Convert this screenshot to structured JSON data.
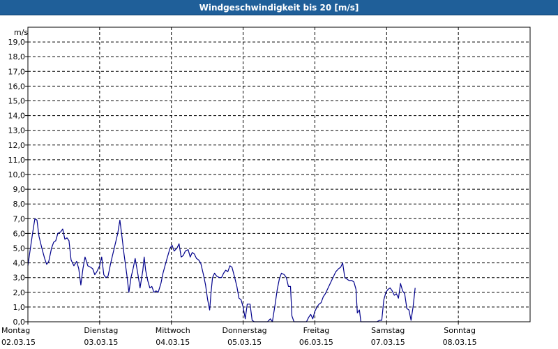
{
  "window": {
    "title": "Windgeschwindigkeit bis 20 [m/s]"
  },
  "chart_data": {
    "type": "line",
    "title": "Windgeschwindigkeit bis 20 [m/s]",
    "ylabel": "m/s",
    "xlabel": "",
    "ylim": [
      0,
      20
    ],
    "xlim": [
      0,
      7
    ],
    "grid": true,
    "line_color": "#00008b",
    "yticks": [
      "19,0",
      "18,0",
      "17,0",
      "16,0",
      "15,0",
      "14,0",
      "13,0",
      "12,0",
      "11,0",
      "10,0",
      "9,0",
      "8,0",
      "7,0",
      "6,0",
      "5,0",
      "4,0",
      "3,0",
      "2,0",
      "1,0",
      "0,0"
    ],
    "xticks": [
      {
        "day": "Montag",
        "date": "02.03.15"
      },
      {
        "day": "Dienstag",
        "date": "03.03.15"
      },
      {
        "day": "Mittwoch",
        "date": "04.03.15"
      },
      {
        "day": "Donnerstag",
        "date": "05.03.15"
      },
      {
        "day": "Freitag",
        "date": "06.03.15"
      },
      {
        "day": "Samstag",
        "date": "07.03.15"
      },
      {
        "day": "Sonntag",
        "date": "08.03.15"
      }
    ],
    "series": [
      {
        "points": [
          [
            0.0,
            3.8
          ],
          [
            0.029,
            4.8
          ],
          [
            0.068,
            6.1
          ],
          [
            0.097,
            7.0
          ],
          [
            0.126,
            6.9
          ],
          [
            0.155,
            5.8
          ],
          [
            0.194,
            5.0
          ],
          [
            0.233,
            4.3
          ],
          [
            0.262,
            3.9
          ],
          [
            0.291,
            4.1
          ],
          [
            0.33,
            5.0
          ],
          [
            0.359,
            5.4
          ],
          [
            0.388,
            5.5
          ],
          [
            0.417,
            6.0
          ],
          [
            0.456,
            6.1
          ],
          [
            0.485,
            6.3
          ],
          [
            0.515,
            5.6
          ],
          [
            0.544,
            5.7
          ],
          [
            0.573,
            5.5
          ],
          [
            0.602,
            4.2
          ],
          [
            0.641,
            3.8
          ],
          [
            0.68,
            4.1
          ],
          [
            0.709,
            3.6
          ],
          [
            0.738,
            2.5
          ],
          [
            0.767,
            3.6
          ],
          [
            0.796,
            4.4
          ],
          [
            0.835,
            3.8
          ],
          [
            0.874,
            3.7
          ],
          [
            0.903,
            3.6
          ],
          [
            0.932,
            3.2
          ],
          [
            0.961,
            3.4
          ],
          [
            1.0,
            3.8
          ],
          [
            1.029,
            4.4
          ],
          [
            1.058,
            3.2
          ],
          [
            1.087,
            3.0
          ],
          [
            1.117,
            3.1
          ],
          [
            1.155,
            4.0
          ],
          [
            1.184,
            4.6
          ],
          [
            1.223,
            5.4
          ],
          [
            1.252,
            6.0
          ],
          [
            1.282,
            6.9
          ],
          [
            1.311,
            5.8
          ],
          [
            1.34,
            4.6
          ],
          [
            1.379,
            3.2
          ],
          [
            1.408,
            2.0
          ],
          [
            1.437,
            3.0
          ],
          [
            1.466,
            3.6
          ],
          [
            1.495,
            4.3
          ],
          [
            1.534,
            3.2
          ],
          [
            1.563,
            2.3
          ],
          [
            1.602,
            3.5
          ],
          [
            1.621,
            4.4
          ],
          [
            1.641,
            3.5
          ],
          [
            1.67,
            2.8
          ],
          [
            1.699,
            2.3
          ],
          [
            1.728,
            2.4
          ],
          [
            1.757,
            2.0
          ],
          [
            1.786,
            2.1
          ],
          [
            1.816,
            2.0
          ],
          [
            1.854,
            2.6
          ],
          [
            1.883,
            3.3
          ],
          [
            1.922,
            4.0
          ],
          [
            1.951,
            4.5
          ],
          [
            1.981,
            5.0
          ],
          [
            2.01,
            5.2
          ],
          [
            2.039,
            4.8
          ],
          [
            2.078,
            5.0
          ],
          [
            2.107,
            5.3
          ],
          [
            2.136,
            4.4
          ],
          [
            2.165,
            4.5
          ],
          [
            2.194,
            4.8
          ],
          [
            2.233,
            4.9
          ],
          [
            2.262,
            4.4
          ],
          [
            2.291,
            4.7
          ],
          [
            2.32,
            4.6
          ],
          [
            2.35,
            4.3
          ],
          [
            2.379,
            4.2
          ],
          [
            2.408,
            4.0
          ],
          [
            2.447,
            3.2
          ],
          [
            2.476,
            2.5
          ],
          [
            2.505,
            1.5
          ],
          [
            2.534,
            0.8
          ],
          [
            2.553,
            2.0
          ],
          [
            2.573,
            3.0
          ],
          [
            2.602,
            3.3
          ],
          [
            2.631,
            3.1
          ],
          [
            2.67,
            3.0
          ],
          [
            2.699,
            3.0
          ],
          [
            2.728,
            3.3
          ],
          [
            2.757,
            3.5
          ],
          [
            2.786,
            3.4
          ],
          [
            2.816,
            3.8
          ],
          [
            2.845,
            3.7
          ],
          [
            2.883,
            3.0
          ],
          [
            2.913,
            2.4
          ],
          [
            2.942,
            1.6
          ],
          [
            2.971,
            1.5
          ],
          [
            3.0,
            1.0
          ],
          [
            3.029,
            0.2
          ],
          [
            3.058,
            1.2
          ],
          [
            3.097,
            1.2
          ],
          [
            3.126,
            0.1
          ],
          [
            3.155,
            0.0
          ],
          [
            3.34,
            0.0
          ],
          [
            3.379,
            0.2
          ],
          [
            3.408,
            0.0
          ],
          [
            3.447,
            1.2
          ],
          [
            3.476,
            2.2
          ],
          [
            3.505,
            2.9
          ],
          [
            3.534,
            3.3
          ],
          [
            3.573,
            3.2
          ],
          [
            3.602,
            3.0
          ],
          [
            3.631,
            2.4
          ],
          [
            3.66,
            2.4
          ],
          [
            3.68,
            0.4
          ],
          [
            3.709,
            0.0
          ],
          [
            3.883,
            0.0
          ],
          [
            3.913,
            0.3
          ],
          [
            3.942,
            0.5
          ],
          [
            3.971,
            0.2
          ],
          [
            4.0,
            0.7
          ],
          [
            4.029,
            1.0
          ],
          [
            4.058,
            1.2
          ],
          [
            4.087,
            1.3
          ],
          [
            4.117,
            1.7
          ],
          [
            4.146,
            1.9
          ],
          [
            4.175,
            2.2
          ],
          [
            4.204,
            2.5
          ],
          [
            4.233,
            2.8
          ],
          [
            4.262,
            3.1
          ],
          [
            4.291,
            3.4
          ],
          [
            4.33,
            3.6
          ],
          [
            4.359,
            3.7
          ],
          [
            4.388,
            4.0
          ],
          [
            4.417,
            3.0
          ],
          [
            4.447,
            2.9
          ],
          [
            4.476,
            2.8
          ],
          [
            4.515,
            2.8
          ],
          [
            4.544,
            2.7
          ],
          [
            4.573,
            2.2
          ],
          [
            4.592,
            0.6
          ],
          [
            4.621,
            0.8
          ],
          [
            4.641,
            0.0
          ],
          [
            4.864,
            0.0
          ],
          [
            4.903,
            0.1
          ],
          [
            4.932,
            0.1
          ],
          [
            4.961,
            1.5
          ],
          [
            4.99,
            2.0
          ],
          [
            5.019,
            2.2
          ],
          [
            5.049,
            2.3
          ],
          [
            5.078,
            2.1
          ],
          [
            5.107,
            1.8
          ],
          [
            5.136,
            1.9
          ],
          [
            5.165,
            1.6
          ],
          [
            5.194,
            2.6
          ],
          [
            5.223,
            2.1
          ],
          [
            5.252,
            1.9
          ],
          [
            5.282,
            0.9
          ],
          [
            5.311,
            0.8
          ],
          [
            5.34,
            0.1
          ],
          [
            5.369,
            1.0
          ],
          [
            5.398,
            2.3
          ]
        ]
      }
    ]
  }
}
